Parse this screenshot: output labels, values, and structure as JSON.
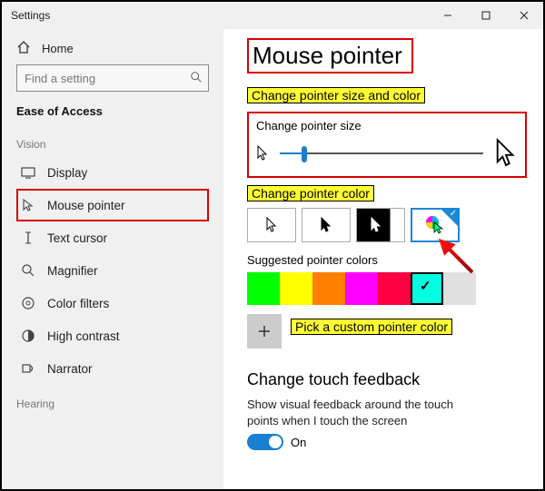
{
  "title": "Settings",
  "home_label": "Home",
  "search_placeholder": "Find a setting",
  "category": "Ease of Access",
  "section_vision": "Vision",
  "section_hearing": "Hearing",
  "nav": {
    "display": "Display",
    "mouse_pointer": "Mouse pointer",
    "text_cursor": "Text cursor",
    "magnifier": "Magnifier",
    "color_filters": "Color filters",
    "high_contrast": "High contrast",
    "narrator": "Narrator"
  },
  "page_title": "Mouse pointer",
  "subhead": "Change pointer size and color",
  "size_label": "Change pointer size",
  "color_label": "Change pointer color",
  "suggested_label": "Suggested pointer colors",
  "suggested_colors": [
    "#00ff00",
    "#ffff00",
    "#ff8000",
    "#ff00ff",
    "#ff0040",
    "#00ffe0",
    "#e0e0e0"
  ],
  "selected_color_index": 5,
  "custom_label": "Pick a custom pointer color",
  "touch_head": "Change touch feedback",
  "touch_desc": "Show visual feedback around the touch points when I touch the screen",
  "toggle_state": "On"
}
